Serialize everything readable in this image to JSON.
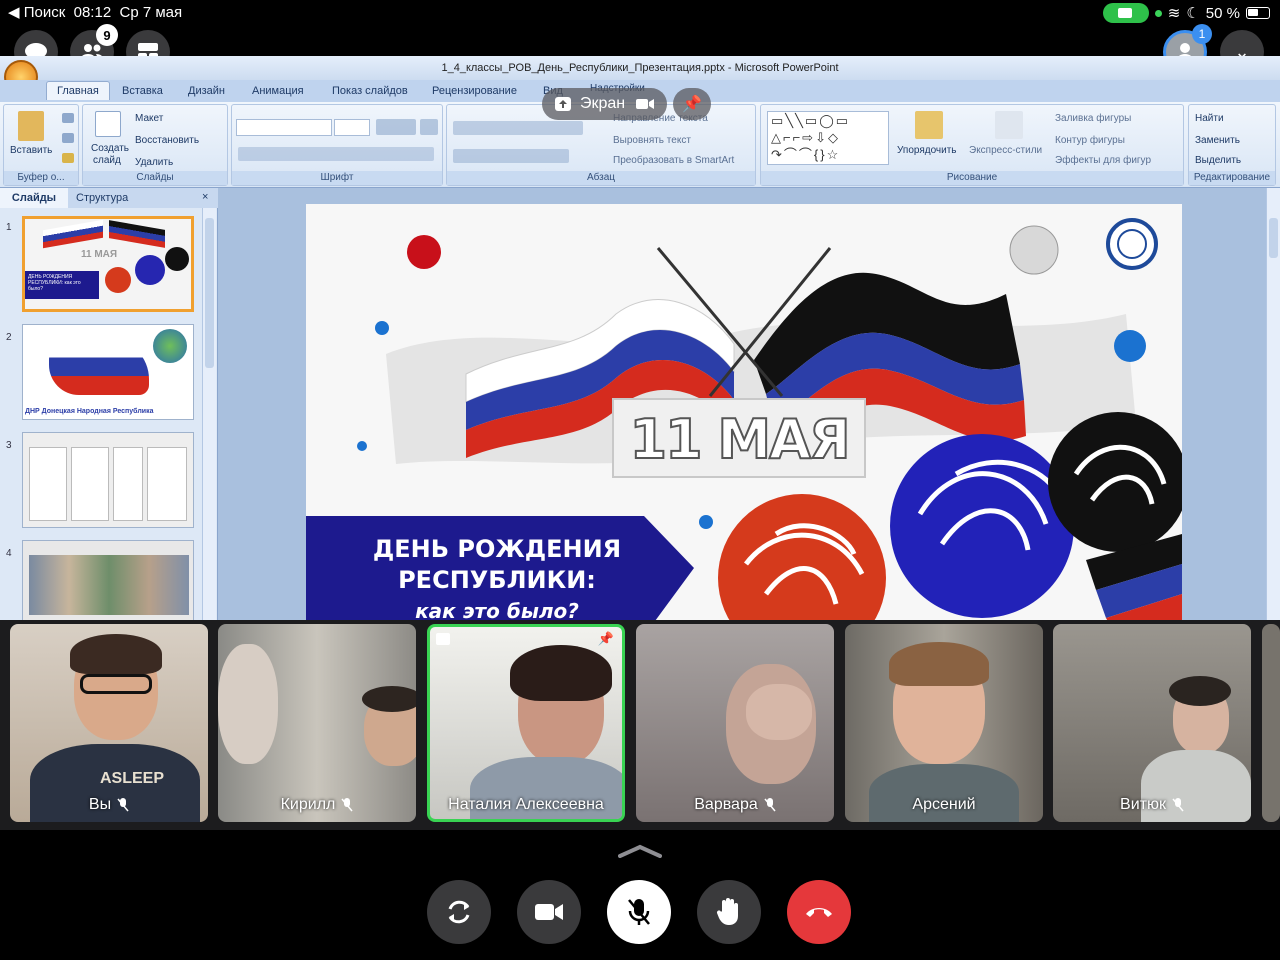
{
  "status_bar": {
    "back_label": "◀ Поиск",
    "time": "08:12",
    "date": "Ср 7 мая",
    "battery": "50 %"
  },
  "call_top": {
    "participants_count": "9",
    "notifications_count": "1"
  },
  "powerpoint": {
    "window_title": "1_4_классы_РОВ_День_Республики_Презентация.pptx - Microsoft PowerPoint",
    "tabs": [
      "Главная",
      "Вставка",
      "Дизайн",
      "Анимация",
      "Показ слайдов",
      "Рецензирование",
      "Вид",
      "Надстройки"
    ],
    "ribbon": {
      "paste": "Вставить",
      "clipboard": "Буфер о...",
      "create_slide": "Создать",
      "create_slide2": "слайд",
      "layout": "Макет",
      "restore": "Восстановить",
      "delete": "Удалить",
      "slides": "Слайды",
      "font": "Шрифт",
      "paragraph": "Абзац",
      "text_direction": "Направление текста",
      "align_text": "Выровнять текст",
      "smartart": "Преобразовать в SmartArt",
      "arrange": "Упорядочить",
      "quick_styles": "Экспресс-стили",
      "fill": "Заливка фигуры",
      "outline": "Контур фигуры",
      "effects": "Эффекты для фигур",
      "drawing": "Рисование",
      "find": "Найти",
      "replace": "Заменить",
      "select": "Выделить",
      "editing": "Редактирование"
    },
    "panel_tabs": [
      "Слайды",
      "Структура"
    ],
    "thumb_numbers": [
      "1",
      "2",
      "3",
      "4"
    ],
    "thumb1_date": "11 МАЯ",
    "thumb1_text": "ДЕНЬ РОЖДЕНИЯ РЕСПУБЛИКИ: как это было?",
    "thumb2_text": "ДНР  Донецкая Народная Республика",
    "slide": {
      "date": "11 МАЯ",
      "title_line1": "ДЕНЬ РОЖДЕНИЯ",
      "title_line2": "РЕСПУБЛИКИ:",
      "subtitle": "как это было?"
    }
  },
  "share_bar": {
    "screen_label": "Экран"
  },
  "participants": [
    {
      "name": "Вы",
      "muted": true
    },
    {
      "name": "Кирилл",
      "muted": true
    },
    {
      "name": "Наталия Алексеевна",
      "muted": false
    },
    {
      "name": "Варвара",
      "muted": true
    },
    {
      "name": "Арсений",
      "muted": false
    },
    {
      "name": "Витюк",
      "muted": true
    }
  ],
  "shirt_text": "ASLEEP",
  "colors": {
    "active_speaker": "#39d353",
    "end_call": "#e5383b",
    "badge": "#3b8ff0"
  }
}
